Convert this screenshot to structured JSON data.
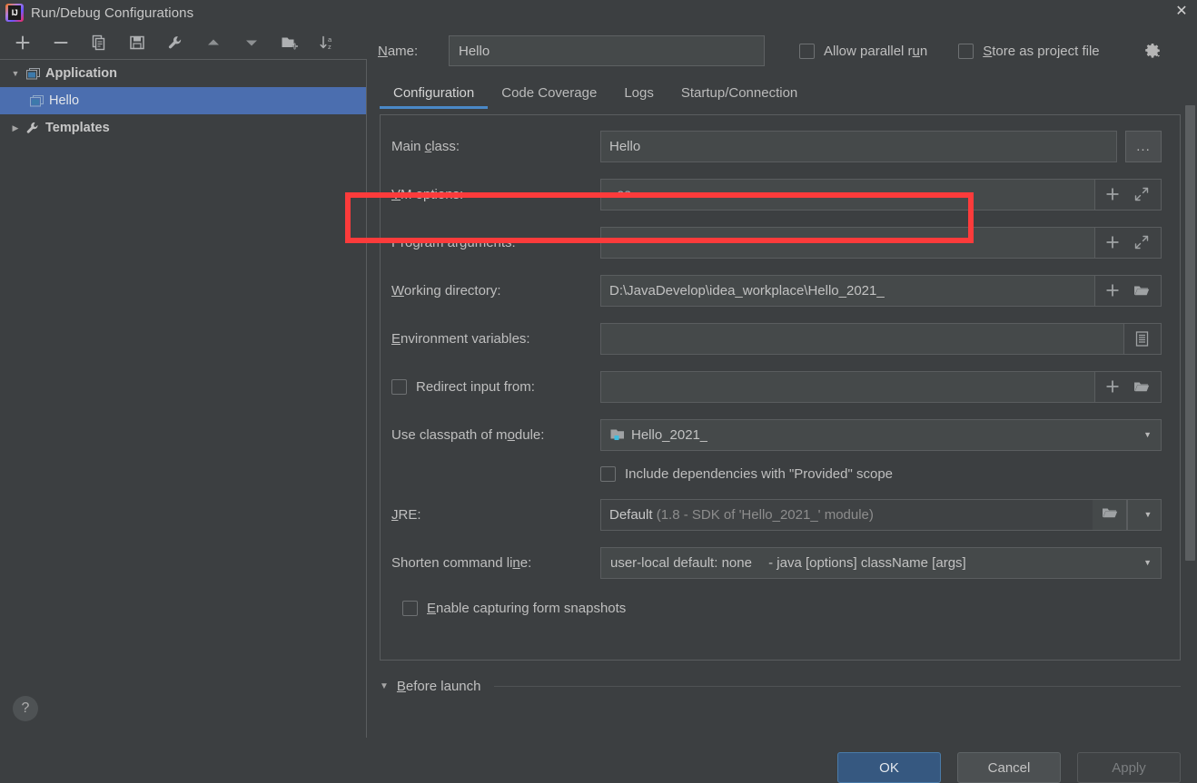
{
  "window": {
    "title": "Run/Debug Configurations",
    "close_label": "✕",
    "app_icon": "intellij-idea-logo"
  },
  "toolbar": {
    "items": [
      {
        "name": "add-configuration-button",
        "icon": "plus-icon"
      },
      {
        "name": "remove-configuration-button",
        "icon": "minus-icon"
      },
      {
        "name": "copy-configuration-button",
        "icon": "copy-icon"
      },
      {
        "name": "save-configuration-button",
        "icon": "save-icon"
      },
      {
        "name": "edit-templates-button",
        "icon": "wrench-icon"
      },
      {
        "name": "move-up-button",
        "icon": "arrow-up-icon"
      },
      {
        "name": "move-down-button",
        "icon": "arrow-down-icon"
      },
      {
        "name": "new-folder-button",
        "icon": "folder-plus-icon"
      },
      {
        "name": "sort-configurations-button",
        "icon": "sort-az-icon"
      }
    ]
  },
  "tree": {
    "nodes": [
      {
        "label": "Application",
        "icon": "application-icon",
        "expanded": true,
        "twisty": "▼",
        "selected": false,
        "bold": true
      },
      {
        "label": "Hello",
        "icon": "application-icon",
        "twisty": "",
        "selected": true,
        "bold": false
      },
      {
        "label": "Templates",
        "icon": "wrench-icon",
        "expanded": false,
        "twisty": "▶",
        "selected": false,
        "bold": true
      }
    ]
  },
  "help": {
    "label": "?"
  },
  "header": {
    "name_label": "Name:",
    "name_label_mnemonic": "N",
    "name_value": "Hello",
    "name_placeholder": "",
    "allow_parallel_run": {
      "label": "Allow parallel run",
      "checked": false
    },
    "store_as_project_file": {
      "label": "Store as project file",
      "checked": false
    },
    "gear_icon": "gear-dropdown-icon"
  },
  "tabs": [
    {
      "label": "Configuration",
      "active": true
    },
    {
      "label": "Code Coverage",
      "active": false
    },
    {
      "label": "Logs",
      "active": false
    },
    {
      "label": "Startup/Connection",
      "active": false
    }
  ],
  "form": {
    "main_class": {
      "label": "Main class:",
      "value": "Hello",
      "browse_label": "..."
    },
    "vm_options": {
      "label": "VM options:",
      "value": "-ea",
      "actions": [
        "macro-plus-icon",
        "expand-icon"
      ]
    },
    "program_arguments": {
      "label": "Program arguments:",
      "value": "",
      "actions": [
        "macro-plus-icon",
        "expand-icon"
      ]
    },
    "working_directory": {
      "label": "Working directory:",
      "value": "D:\\JavaDevelop\\idea_workplace\\Hello_2021_",
      "actions": [
        "macro-plus-icon",
        "folder-icon"
      ]
    },
    "environment_variables": {
      "label": "Environment variables:",
      "value": "",
      "actions": [
        "env-list-icon"
      ]
    },
    "redirect_input": {
      "label": "Redirect input from:",
      "checked": false,
      "value": "",
      "actions": [
        "macro-plus-icon",
        "folder-icon"
      ]
    },
    "use_classpath_of_module": {
      "label": "Use classpath of module:",
      "value": "Hello_2021_",
      "icon": "module-icon"
    },
    "include_provided": {
      "label": "Include dependencies with \"Provided\" scope",
      "checked": false
    },
    "jre": {
      "label": "JRE:",
      "value": "Default",
      "value_hint": "(1.8 - SDK of 'Hello_2021_' module)"
    },
    "shorten_command_line": {
      "label": "Shorten command line:",
      "value": "user-local default: none",
      "value_hint": "- java [options] className [args]"
    },
    "enable_capturing_form_snapshots": {
      "label": "Enable capturing form snapshots",
      "checked": false
    }
  },
  "before_launch": {
    "label": "Before launch",
    "twisty": "▼"
  },
  "footer": {
    "ok": "OK",
    "cancel": "Cancel",
    "apply": "Apply"
  },
  "annotation": {
    "type": "red-rectangle-highlight",
    "target": "vm-options-row",
    "color": "#fc3b3b"
  },
  "colors": {
    "background": "#3c3f41",
    "selection": "#4b6eaf",
    "tab_accent": "#4a88c7",
    "primary_button": "#365880",
    "annotation_red": "#fc3b3b"
  }
}
